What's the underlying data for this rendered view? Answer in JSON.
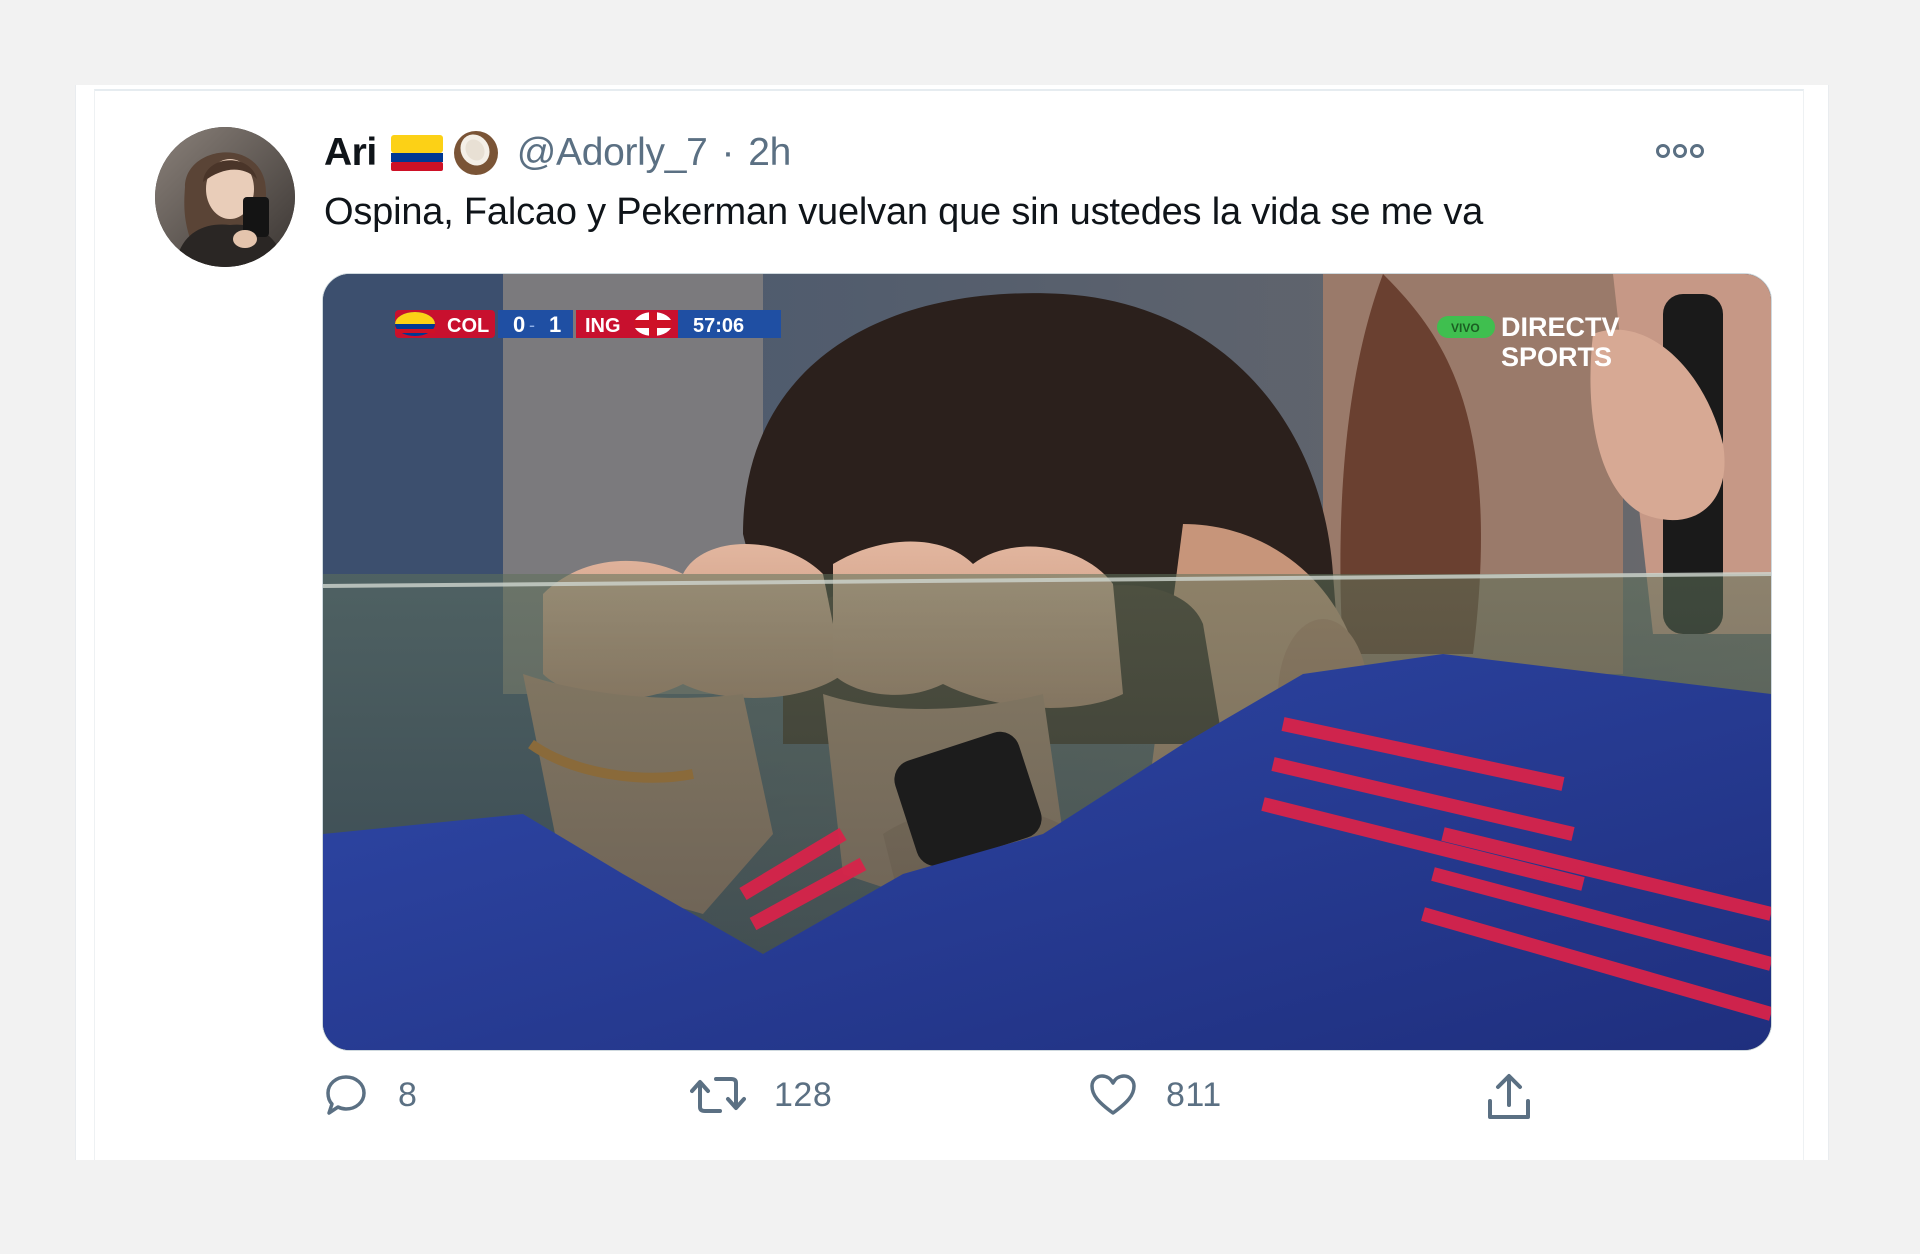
{
  "tweet": {
    "author_name": "Ari",
    "author_emojis": [
      "flag-colombia-icon",
      "coconut-icon"
    ],
    "handle": "@Adorly_7",
    "separator": "·",
    "time": "2h",
    "text": "Ospina, Falcao y Pekerman vuelvan que sin ustedes la vida se me va"
  },
  "media": {
    "scoreboard": {
      "home_team": "COL",
      "home_score": "0",
      "away_score": "1",
      "away_team": "ING",
      "clock": "57:06"
    },
    "broadcaster_line1": "DIRECTV",
    "broadcaster_line2": "SPORTS",
    "live_badge": "VIVO"
  },
  "actions": {
    "reply_count": "8",
    "retweet_count": "128",
    "like_count": "811"
  },
  "colors": {
    "secondary_text": "#5b7083",
    "colombia_yellow": "#fcd116",
    "colombia_blue": "#003893",
    "colombia_red": "#ce1126",
    "scoreboard_red": "#c8102e",
    "scoreboard_blue": "#1f4fa3"
  }
}
